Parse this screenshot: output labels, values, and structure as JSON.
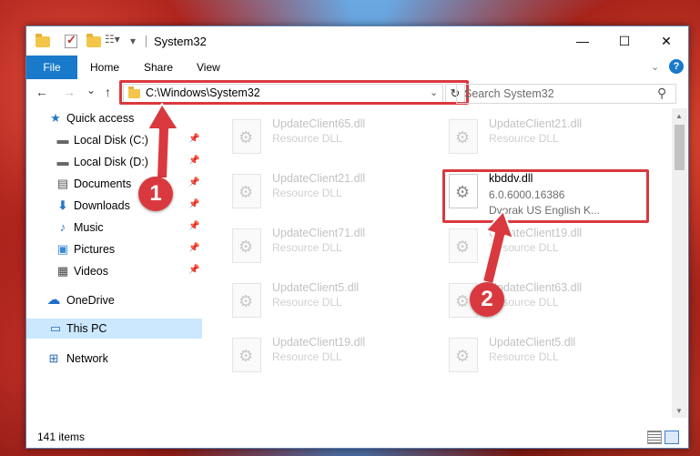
{
  "window": {
    "title": "System32",
    "controls": {
      "minimize": "—",
      "maximize": "☐",
      "close": "✕"
    }
  },
  "ribbon": {
    "tabs": [
      "File",
      "Home",
      "Share",
      "View"
    ],
    "help": "?"
  },
  "nav": {
    "back": "←",
    "forward": "→",
    "recent": "⌄",
    "up": "↑",
    "address": "C:\\Windows\\System32",
    "refresh": "↻",
    "search_placeholder": "Search System32"
  },
  "sidebar": {
    "items": [
      {
        "label": "Quick access",
        "icon": "star-icon",
        "pinned": false
      },
      {
        "label": "Local Disk (C:)",
        "icon": "drive-icon",
        "pinned": true
      },
      {
        "label": "Local Disk (D:)",
        "icon": "drive-icon",
        "pinned": true
      },
      {
        "label": "Documents",
        "icon": "documents-icon",
        "pinned": true
      },
      {
        "label": "Downloads",
        "icon": "download-icon",
        "pinned": true
      },
      {
        "label": "Music",
        "icon": "music-icon",
        "pinned": true
      },
      {
        "label": "Pictures",
        "icon": "pictures-icon",
        "pinned": true
      },
      {
        "label": "Videos",
        "icon": "videos-icon",
        "pinned": true
      },
      {
        "label": "OneDrive",
        "icon": "cloud-icon",
        "pinned": false
      },
      {
        "label": "This PC",
        "icon": "computer-icon",
        "pinned": false,
        "selected": true
      },
      {
        "label": "Network",
        "icon": "network-icon",
        "pinned": false
      }
    ]
  },
  "files": {
    "left_column": [
      {
        "name": "UpdateClient65.dll",
        "type": "Resource DLL"
      },
      {
        "name": "UpdateClient21.dll",
        "type": "Resource DLL"
      },
      {
        "name": "UpdateClient71.dll",
        "type": "Resource DLL"
      },
      {
        "name": "UpdateClient5.dll",
        "type": "Resource DLL"
      },
      {
        "name": "UpdateClient19.dll",
        "type": "Resource DLL"
      }
    ],
    "right_column": [
      {
        "name": "UpdateClient21.dll",
        "type": "Resource DLL"
      },
      {
        "name": "UpdateClient19.dll",
        "type": "Resource DLL"
      },
      {
        "name": "UpdateClient63.dll",
        "type": "Resource DLL"
      },
      {
        "name": "UpdateClient5.dll",
        "type": "Resource DLL"
      }
    ],
    "target": {
      "name": "kbddv.dll",
      "version": "6.0.6000.16386",
      "description": "Dvorak US English K..."
    }
  },
  "status": {
    "item_count": "141 items"
  },
  "annotations": {
    "step1": "1",
    "step2": "2",
    "accent_color": "#d9393e"
  }
}
